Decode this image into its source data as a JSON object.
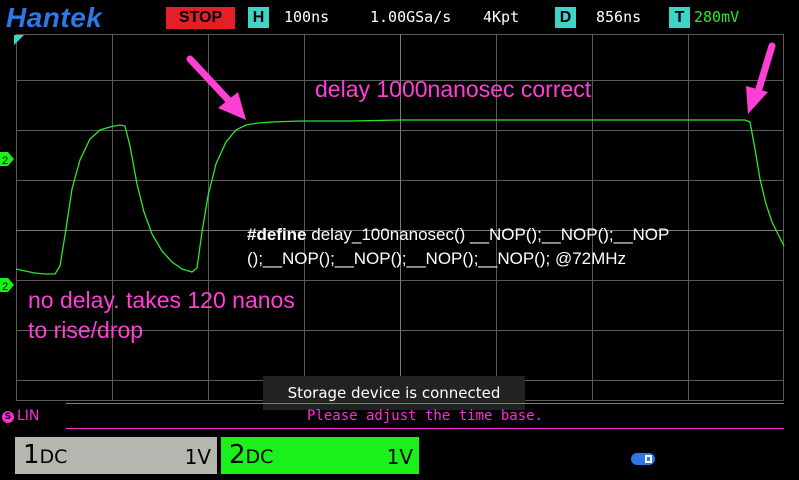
{
  "header": {
    "brand": "Hantek",
    "run_state": "STOP",
    "timebase_badge": "H",
    "timebase": "100ns",
    "sample_rate": "1.00GSa/s",
    "memory_depth": "4Kpt",
    "delay_badge": "D",
    "delay": "856ns",
    "trigger_badge": "T",
    "trigger_level": "280mV"
  },
  "screen": {
    "left_marker_1": "2",
    "left_marker_2": "2",
    "annotations": {
      "title": "delay 1000nanosec correct",
      "code_bold": "#define",
      "code_line1": " delay_100nanosec()  __NOP();__NOP();__NOP",
      "code_line2": "();__NOP();__NOP();__NOP();__NOP(); @72MHz",
      "note_line1": "no delay. takes 120 nanos",
      "note_line2": "to rise/drop"
    },
    "toast": "Storage device is connected"
  },
  "status": {
    "lin_icon": "S",
    "mode": "LIN",
    "message": "Please adjust the time base."
  },
  "channels": [
    {
      "name": "1",
      "coupling": "DC",
      "scale": "1V",
      "color": "#b6b6b0"
    },
    {
      "name": "2",
      "coupling": "DC",
      "scale": "1V",
      "color": "#1cf01c"
    }
  ],
  "colors": {
    "brand": "#2f76e6",
    "stop": "#e3202a",
    "badge": "#3fd4c8",
    "trace": "#2be82b",
    "annotation": "#ff3fd6"
  },
  "icons": [
    "usb-storage-icon",
    "arrow-icon",
    "trigger-marker-icon"
  ]
}
